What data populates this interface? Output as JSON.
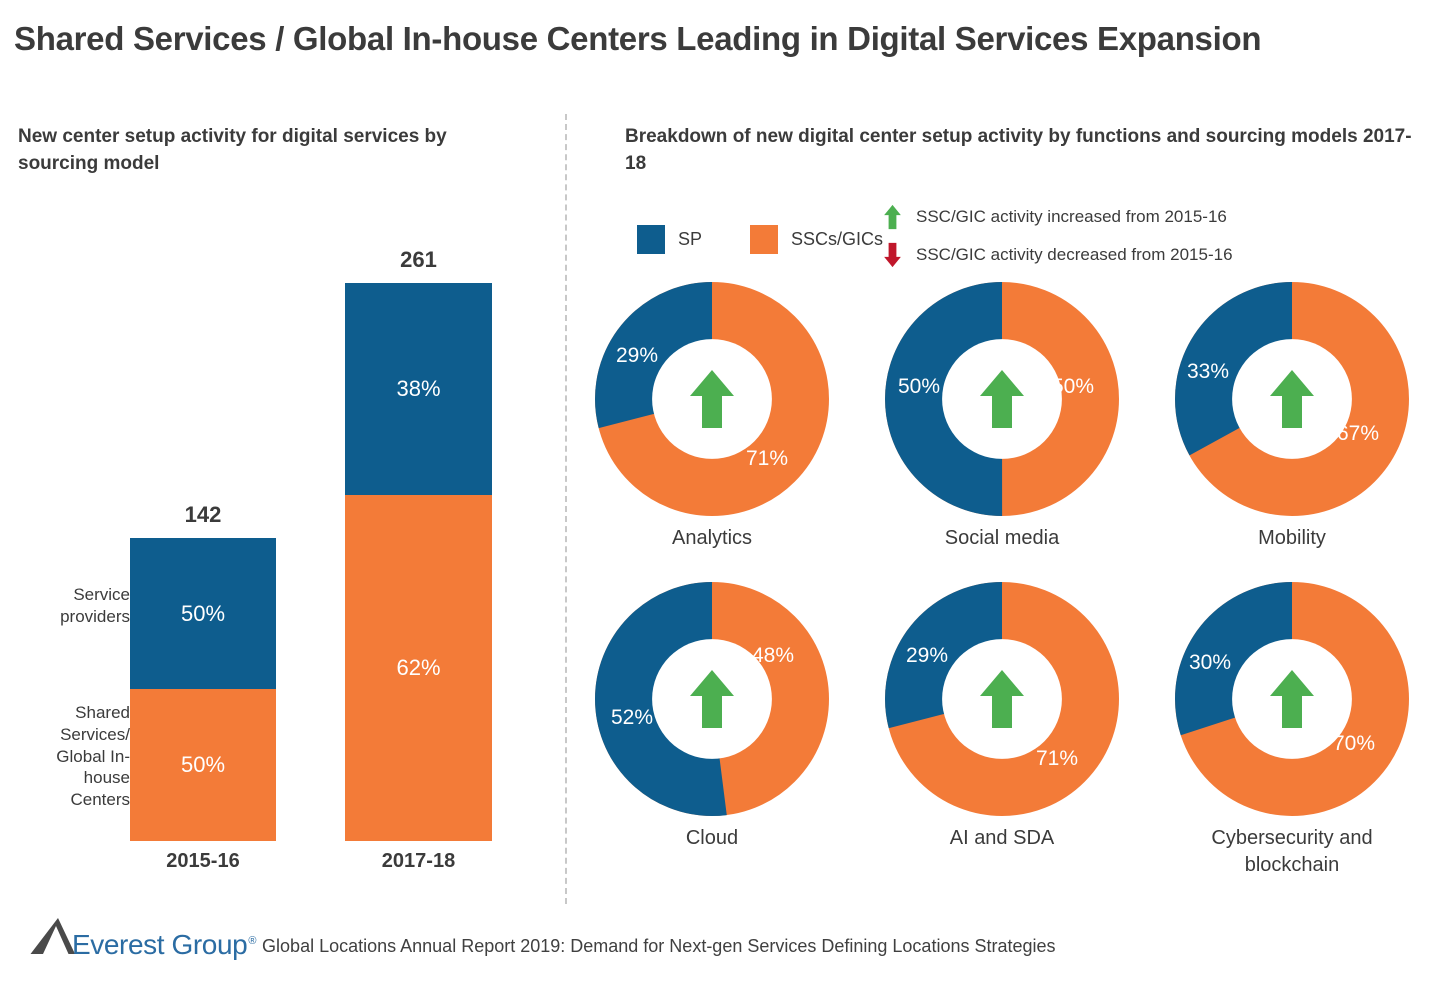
{
  "page_title": "Shared Services / Global In-house Centers Leading in Digital Services Expansion",
  "colors": {
    "sp_blue": "#0e5d8e",
    "ssc_orange": "#f37b38",
    "up_green": "#4caf50",
    "down_red": "#c0172b",
    "text_dark": "#3b3b3b",
    "divider": "#c8c8c8",
    "logo_blue": "#2b6ca3"
  },
  "left_panel": {
    "subtitle": "New center setup activity for digital services by sourcing model",
    "category_labels": {
      "sp": "Service providers",
      "ssc": "Shared Services/ Global In-house Centers"
    },
    "bars": [
      {
        "x_label": "2015-16",
        "total": "142",
        "total_value": 142,
        "segments": [
          {
            "series": "SP",
            "label": "50%",
            "value": 50
          },
          {
            "series": "SSCs/GICs",
            "label": "50%",
            "value": 50
          }
        ]
      },
      {
        "x_label": "2017-18",
        "total": "261",
        "total_value": 261,
        "segments": [
          {
            "series": "SP",
            "label": "38%",
            "value": 38
          },
          {
            "series": "SSCs/GICs",
            "label": "62%",
            "value": 62
          }
        ]
      }
    ]
  },
  "right_panel": {
    "subtitle": "Breakdown of new digital center setup activity by functions and sourcing models 2017-18",
    "legend": {
      "sp_label": "SP",
      "ssc_label": "SSCs/GICs",
      "increase_label": "SSC/GIC activity increased from 2015-16",
      "decrease_label": "SSC/GIC activity decreased from 2015-16"
    },
    "donuts": [
      {
        "label": "Analytics",
        "sp": "29%",
        "ssc": "71%",
        "sp_value": 29,
        "ssc_value": 71,
        "trend": "up"
      },
      {
        "label": "Social media",
        "sp": "50%",
        "ssc": "50%",
        "sp_value": 50,
        "ssc_value": 50,
        "trend": "up"
      },
      {
        "label": "Mobility",
        "sp": "33%",
        "ssc": "67%",
        "sp_value": 33,
        "ssc_value": 67,
        "trend": "up"
      },
      {
        "label": "Cloud",
        "sp": "52%",
        "ssc": "48%",
        "sp_value": 52,
        "ssc_value": 48,
        "trend": "up"
      },
      {
        "label": "AI and SDA",
        "sp": "29%",
        "ssc": "71%",
        "sp_value": 29,
        "ssc_value": 71,
        "trend": "up"
      },
      {
        "label": "Cybersecurity and blockchain",
        "sp": "30%",
        "ssc": "70%",
        "sp_value": 30,
        "ssc_value": 70,
        "trend": "up"
      }
    ]
  },
  "footer": {
    "logo_word": "Everest Group",
    "logo_registered": "®",
    "source": "Global Locations Annual Report 2019: Demand for Next-gen Services Defining Locations Strategies"
  },
  "chart_data": [
    {
      "type": "bar",
      "title": "New center setup activity for digital services by sourcing model",
      "subtype": "stacked-100-percent",
      "categories": [
        "2015-16",
        "2017-18"
      ],
      "totals": [
        142,
        261
      ],
      "series": [
        {
          "name": "Service providers",
          "values": [
            50,
            38
          ],
          "color": "#0e5d8e"
        },
        {
          "name": "Shared Services/ Global In-house Centers",
          "values": [
            50,
            62
          ],
          "color": "#f37b38"
        }
      ],
      "xlabel": "",
      "ylabel": "",
      "unit": "percent",
      "grid": false,
      "legend": "left-axis-labels"
    },
    {
      "type": "pie",
      "subtype": "donut-grid",
      "title": "Breakdown of new digital center setup activity by functions and sourcing models 2017-18",
      "legend": "top",
      "legend_entries": [
        "SP",
        "SSCs/GICs"
      ],
      "categories": [
        "Analytics",
        "Social media",
        "Mobility",
        "Cloud",
        "AI and SDA",
        "Cybersecurity and blockchain"
      ],
      "series": [
        {
          "name": "SP",
          "values": [
            29,
            50,
            33,
            52,
            29,
            30
          ],
          "color": "#0e5d8e"
        },
        {
          "name": "SSCs/GICs",
          "values": [
            71,
            50,
            67,
            48,
            71,
            70
          ],
          "color": "#f37b38"
        }
      ],
      "annotations": [
        "up",
        "up",
        "up",
        "up",
        "up",
        "up"
      ],
      "annotation_legend": {
        "up": "SSC/GIC activity increased from 2015-16",
        "down": "SSC/GIC activity decreased from 2015-16"
      },
      "unit": "percent"
    }
  ]
}
